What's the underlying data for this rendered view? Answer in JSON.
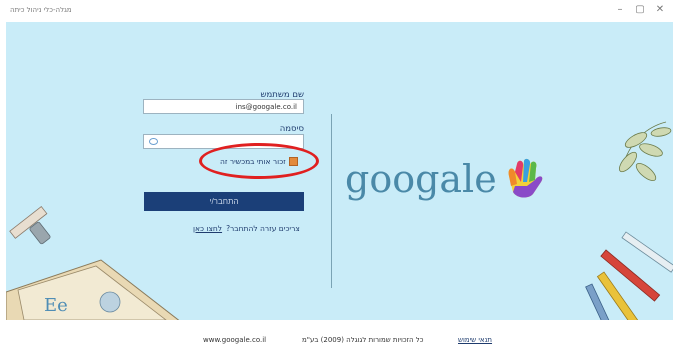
{
  "window": {
    "title": "מגלה-כלי ניהול כיתה",
    "minimize": "–",
    "maximize": "▢",
    "close": "✕"
  },
  "logo": {
    "text": "googale"
  },
  "form": {
    "username_label": "שם משתמש",
    "username_value": "ins@googale.co.il",
    "password_label": "סיסמה",
    "password_value": "",
    "remember_label": "זכור אותי במכשיר זה",
    "login_button": "התחבר/י",
    "help_text": "צריכים עזרה להתחבר?",
    "help_link": "לחצו כאן"
  },
  "footer": {
    "site": "www.googale.co.il",
    "copyright": "כל הזכויות שמורות לגוגלה (2009) בע\"מ",
    "terms": "תנאי שימוש"
  },
  "colors": {
    "background": "#c9ecf8",
    "button": "#1b3f78",
    "highlight": "#e02020"
  }
}
